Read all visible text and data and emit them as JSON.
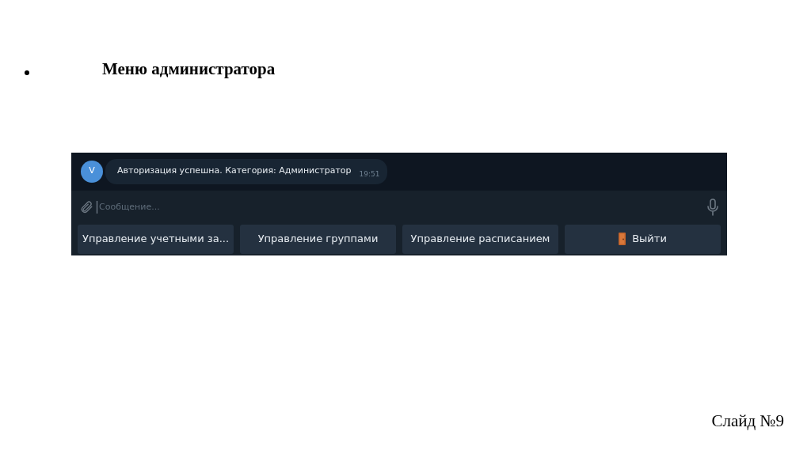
{
  "slide": {
    "title": "Меню администратора",
    "footer": "Слайд №9"
  },
  "chat": {
    "message": {
      "avatar": "V",
      "text": "Авторизация успешна. Категория: Администратор",
      "time": "19:51"
    },
    "input": {
      "placeholder": "Сообщение..."
    },
    "buttons": [
      {
        "label": "Управление учетными за...",
        "kind": "plain"
      },
      {
        "label": "Управление группами",
        "kind": "plain"
      },
      {
        "label": "Управление расписанием",
        "kind": "plain"
      },
      {
        "label": "Выйти",
        "kind": "door"
      }
    ]
  }
}
